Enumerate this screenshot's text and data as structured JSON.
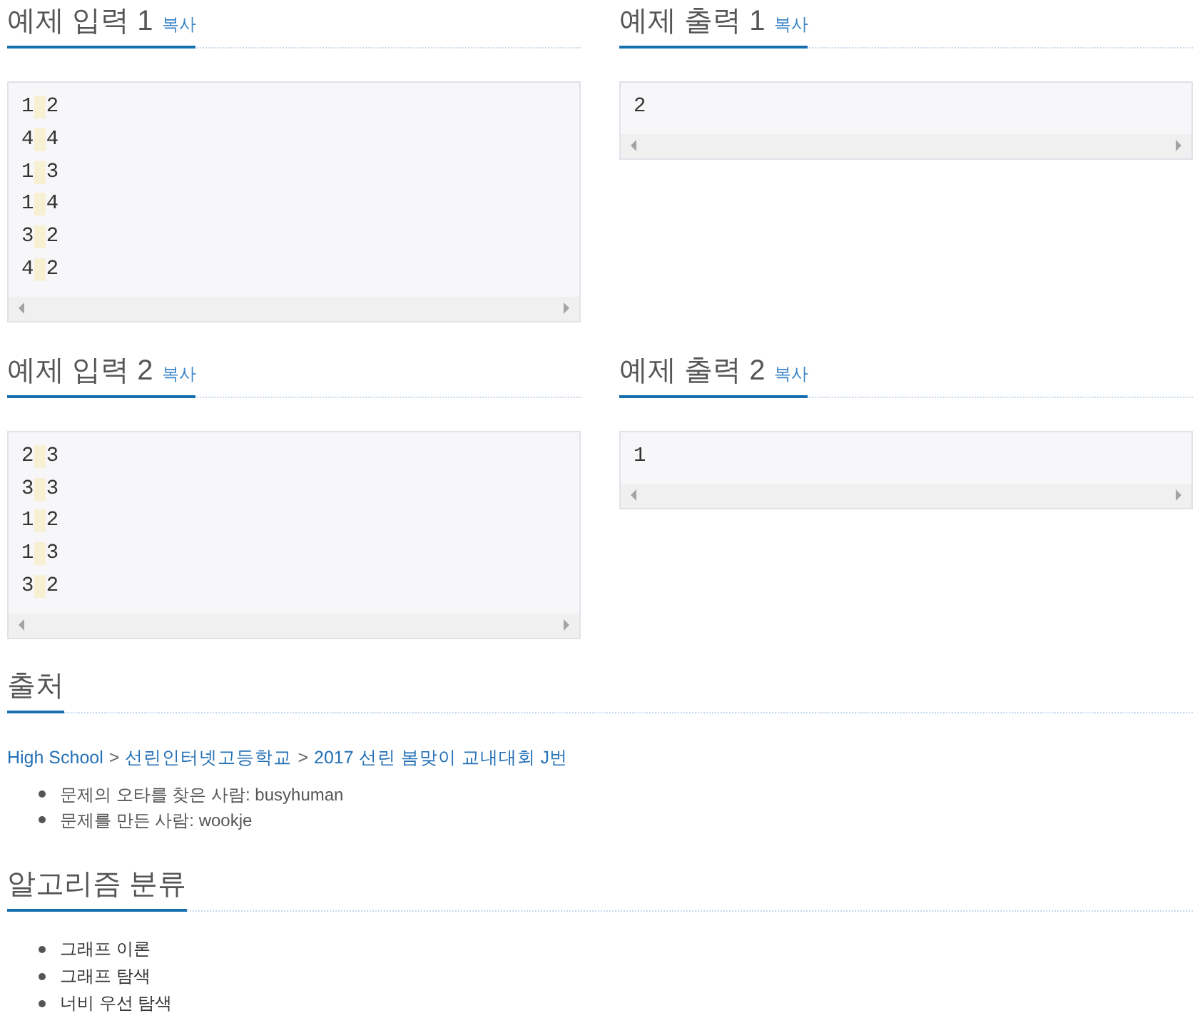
{
  "samples": [
    {
      "title": "예제 입력 1",
      "copy_link": "복사",
      "lines": [
        "1 2",
        "4 4",
        "1 3",
        "1 4",
        "3 2",
        "4 2"
      ]
    },
    {
      "title": "예제 출력 1",
      "copy_link": "복사",
      "lines": [
        "2"
      ]
    },
    {
      "title": "예제 입력 2",
      "copy_link": "복사",
      "lines": [
        "2 3",
        "3 3",
        "1 2",
        "1 3",
        "3 2"
      ]
    },
    {
      "title": "예제 출력 2",
      "copy_link": "복사",
      "lines": [
        "1"
      ]
    }
  ],
  "source": {
    "title": "출처",
    "breadcrumb": [
      {
        "kind": "link",
        "text": "High School"
      },
      {
        "kind": "separator",
        "text": ">"
      },
      {
        "kind": "link",
        "text": "선린인터넷고등학교"
      },
      {
        "kind": "separator",
        "text": ">"
      },
      {
        "kind": "link",
        "text": "2017 선린 봄맞이 교내대회 J번"
      }
    ],
    "credits": [
      "문제의 오타를 찾은 사람: busyhuman",
      "문제를 만든 사람: wookje"
    ]
  },
  "algorithm": {
    "title": "알고리즘 분류",
    "tags": [
      "그래프 이론",
      "그래프 탐색",
      "너비 우선 탐색"
    ]
  }
}
